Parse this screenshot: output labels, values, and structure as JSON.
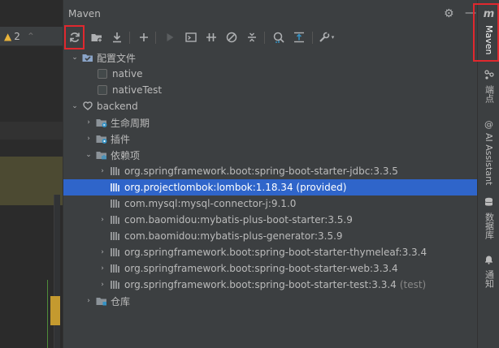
{
  "editor": {
    "warning_count": "2"
  },
  "panel": {
    "title": "Maven"
  },
  "toolbar": {
    "buttons": [
      "reload",
      "add-folder",
      "download",
      "add",
      "run",
      "lifecycle",
      "toggle",
      "skip-tests",
      "collapse",
      "analyze",
      "show-deps",
      "settings"
    ]
  },
  "tree": {
    "profiles": {
      "label": "配置文件",
      "items": [
        "native",
        "nativeTest"
      ]
    },
    "project": {
      "label": "backend"
    },
    "lifecycle": {
      "label": "生命周期"
    },
    "plugins": {
      "label": "插件"
    },
    "dependencies": {
      "label": "依赖项",
      "items": [
        {
          "label": "org.springframework.boot:spring-boot-starter-jdbc:3.3.5",
          "suffix": ""
        },
        {
          "label": "org.projectlombok:lombok:1.18.34 (provided)",
          "suffix": ""
        },
        {
          "label": "com.mysql:mysql-connector-j:9.1.0",
          "suffix": ""
        },
        {
          "label": "com.baomidou:mybatis-plus-boot-starter:3.5.9",
          "suffix": ""
        },
        {
          "label": "com.baomidou:mybatis-plus-generator:3.5.9",
          "suffix": ""
        },
        {
          "label": "org.springframework.boot:spring-boot-starter-thymeleaf:3.3.4",
          "suffix": ""
        },
        {
          "label": "org.springframework.boot:spring-boot-starter-web:3.3.4",
          "suffix": ""
        },
        {
          "label": "org.springframework.boot:spring-boot-starter-test:3.3.4",
          "suffix": "(test)"
        }
      ]
    },
    "repositories": {
      "label": "仓库"
    }
  },
  "strip": {
    "maven_glyph": "m",
    "maven": "Maven",
    "endpoints": "端点",
    "ai": "AI Assistant",
    "database": "数据库",
    "notifications": "通知"
  },
  "colors": {
    "highlight": "#e0282e",
    "selection": "#2f65ca",
    "accent": "#3592c4"
  }
}
